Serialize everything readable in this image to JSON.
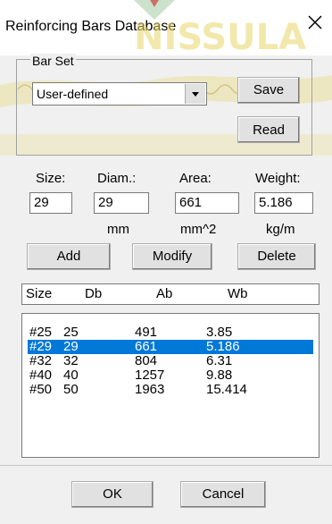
{
  "dialog": {
    "title": "Reinforcing Bars Database"
  },
  "bar_set": {
    "legend": "Bar Set",
    "selected": "User-defined",
    "save_label": "Save",
    "read_label": "Read"
  },
  "fields": {
    "size": {
      "label": "Size:",
      "value": "29"
    },
    "diam": {
      "label": "Diam.:",
      "value": "29",
      "unit": "mm"
    },
    "area": {
      "label": "Area:",
      "value": "661",
      "unit": "mm^2"
    },
    "weight": {
      "label": "Weight:",
      "value": "5.186",
      "unit": "kg/m"
    }
  },
  "actions": {
    "add": "Add",
    "modify": "Modify",
    "delete": "Delete"
  },
  "table": {
    "headers": [
      "Size",
      "Db",
      "Ab",
      "Wb"
    ],
    "rows": [
      [
        "#25",
        "25",
        "491",
        "3.85"
      ],
      [
        "#29",
        "29",
        "661",
        "5.186"
      ],
      [
        "#32",
        "32",
        "804",
        "6.31"
      ],
      [
        "#40",
        "40",
        "1257",
        "9.88"
      ],
      [
        "#50",
        "50",
        "1963",
        "15.414"
      ]
    ],
    "selected_index": 1
  },
  "footer": {
    "ok": "OK",
    "cancel": "Cancel"
  },
  "colors": {
    "selection": "#0078d7",
    "watermark": "#e9d76a"
  },
  "icons": {
    "close": "close-icon",
    "dropdown": "chevron-down-icon"
  }
}
